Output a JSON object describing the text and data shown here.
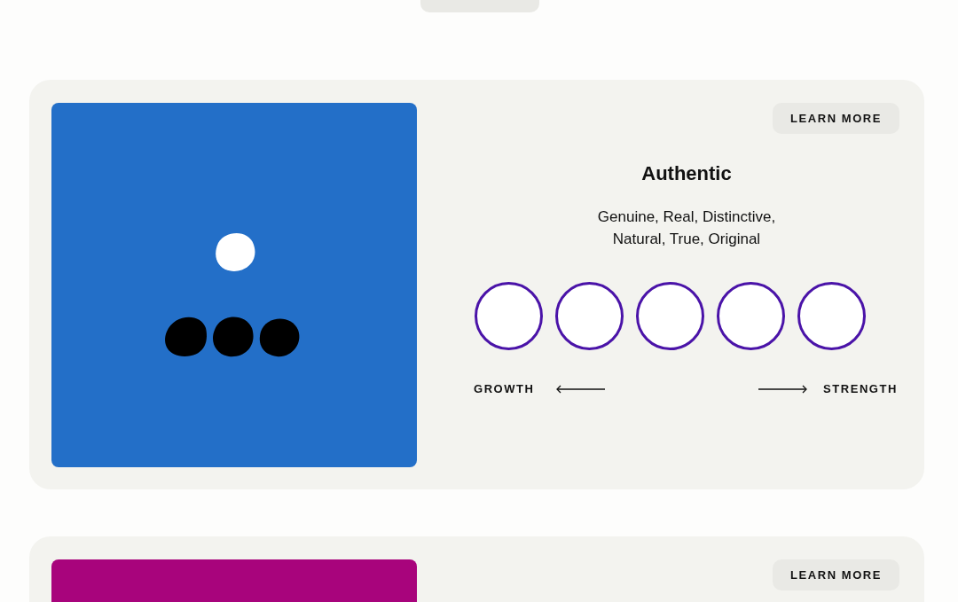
{
  "cards": [
    {
      "kind": "scale",
      "color": "#236fc8",
      "button": "LEARN MORE",
      "title": "Authentic",
      "synonyms": "Genuine, Real, Distinctive,\nNatural, True, Original",
      "options": [
        {
          "selected": false
        },
        {
          "selected": false
        },
        {
          "selected": false
        },
        {
          "selected": false
        },
        {
          "selected": false
        }
      ],
      "left_label": "GROWTH",
      "right_label": "STRENGTH"
    },
    {
      "kind": "partial",
      "color": "#a8047c",
      "button": "LEARN MORE"
    }
  ]
}
